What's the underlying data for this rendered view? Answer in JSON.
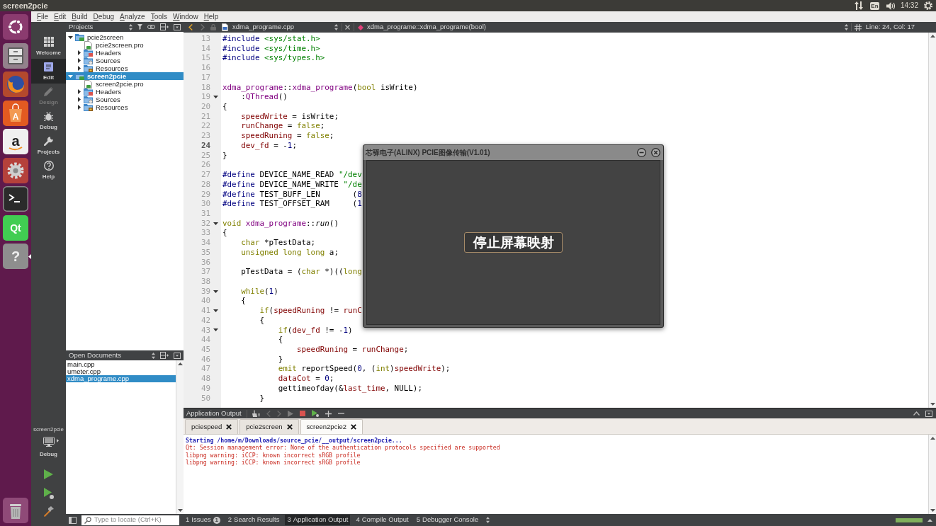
{
  "top_panel": {
    "title": "screen2pcie",
    "keyboard": "En",
    "time": "14:32"
  },
  "launcher": [
    {
      "kind": "dash",
      "focused": false
    },
    {
      "kind": "files",
      "focused": false
    },
    {
      "kind": "browser",
      "focused": false
    },
    {
      "kind": "software",
      "glyph": "A",
      "focused": false
    },
    {
      "kind": "store",
      "glyph": "a",
      "focused": false
    },
    {
      "kind": "settings",
      "focused": false
    },
    {
      "kind": "terminal",
      "focused": false
    },
    {
      "kind": "qt",
      "glyph": "Qt",
      "focused": false
    },
    {
      "kind": "help",
      "glyph": "?",
      "focused": true
    },
    {
      "kind": "trash",
      "focused": false
    }
  ],
  "menu": [
    "File",
    "Edit",
    "Build",
    "Debug",
    "Analyze",
    "Tools",
    "Window",
    "Help"
  ],
  "modes": [
    {
      "label": "Welcome",
      "selected": false,
      "disabled": false
    },
    {
      "label": "Edit",
      "selected": true,
      "disabled": false
    },
    {
      "label": "Design",
      "selected": false,
      "disabled": true
    },
    {
      "label": "Debug",
      "selected": false,
      "disabled": false
    },
    {
      "label": "Projects",
      "selected": false,
      "disabled": false
    },
    {
      "label": "Help",
      "selected": false,
      "disabled": false
    }
  ],
  "kit": {
    "project": "screen2pcie",
    "config": "Debug"
  },
  "projects": {
    "title": "Projects",
    "tree": [
      {
        "name": "pcie2screen",
        "kind": "project",
        "expanded": true,
        "selected": false,
        "children": [
          {
            "name": "pcie2screen.pro",
            "kind": "profile",
            "selected": false
          },
          {
            "name": "Headers",
            "kind": "headers",
            "expanded": false,
            "selected": false
          },
          {
            "name": "Sources",
            "kind": "sources",
            "expanded": false,
            "selected": false
          },
          {
            "name": "Resources",
            "kind": "resources",
            "expanded": false,
            "selected": false
          }
        ]
      },
      {
        "name": "screen2pcie",
        "kind": "project",
        "expanded": true,
        "selected": true,
        "children": [
          {
            "name": "screen2pcie.pro",
            "kind": "profile",
            "selected": false
          },
          {
            "name": "Headers",
            "kind": "headers",
            "expanded": false,
            "selected": false
          },
          {
            "name": "Sources",
            "kind": "sources",
            "expanded": false,
            "selected": false
          },
          {
            "name": "Resources",
            "kind": "resources",
            "expanded": false,
            "selected": false
          }
        ]
      }
    ]
  },
  "open_documents": {
    "title": "Open Documents",
    "items": [
      {
        "name": "main.cpp",
        "selected": false
      },
      {
        "name": "umeter.cpp",
        "selected": false
      },
      {
        "name": "xdma_programe.cpp",
        "selected": true
      }
    ]
  },
  "editor": {
    "file": "xdma_programe.cpp",
    "symbol": "xdma_programe::xdma_programe(bool)",
    "position": "Line: 24, Col: 17",
    "lines": [
      {
        "number": "13",
        "foldable": false,
        "current": false,
        "tokens": [
          {
            "text": "#include",
            "kind": "preprocessor"
          },
          {
            "text": " <sys/stat.h>",
            "kind": "string"
          }
        ]
      },
      {
        "number": "14",
        "foldable": false,
        "current": false,
        "tokens": [
          {
            "text": "#include",
            "kind": "preprocessor"
          },
          {
            "text": " <sys/time.h>",
            "kind": "string"
          }
        ]
      },
      {
        "number": "15",
        "foldable": false,
        "current": false,
        "tokens": [
          {
            "text": "#include",
            "kind": "preprocessor"
          },
          {
            "text": " <sys/types.h>",
            "kind": "string"
          }
        ]
      },
      {
        "number": "16",
        "foldable": false,
        "current": false
      },
      {
        "number": "17",
        "foldable": false,
        "current": false
      },
      {
        "number": "18",
        "foldable": false,
        "current": false,
        "tokens": [
          {
            "text": "xdma_programe",
            "kind": "type"
          },
          {
            "text": "::",
            "kind": "plain"
          },
          {
            "text": "xdma_programe",
            "kind": "type"
          },
          {
            "text": "(",
            "kind": "plain"
          },
          {
            "text": "bool",
            "kind": "keyword"
          },
          {
            "text": " isWrite)",
            "kind": "plain"
          }
        ]
      },
      {
        "number": "19",
        "foldable": true,
        "current": false,
        "tokens": [
          {
            "text": "    :",
            "kind": "plain"
          },
          {
            "text": "QThread",
            "kind": "type"
          },
          {
            "text": "()",
            "kind": "plain"
          }
        ]
      },
      {
        "number": "20",
        "foldable": false,
        "current": false,
        "tokens": [
          {
            "text": "{",
            "kind": "plain"
          }
        ]
      },
      {
        "number": "21",
        "foldable": false,
        "current": false,
        "tokens": [
          {
            "text": "    speedWrite",
            "kind": "field"
          },
          {
            "text": " = isWrite;",
            "kind": "plain"
          }
        ]
      },
      {
        "number": "22",
        "foldable": false,
        "current": false,
        "tokens": [
          {
            "text": "    runChange",
            "kind": "field"
          },
          {
            "text": " = ",
            "kind": "plain"
          },
          {
            "text": "false",
            "kind": "keyword"
          },
          {
            "text": ";",
            "kind": "plain"
          }
        ]
      },
      {
        "number": "23",
        "foldable": false,
        "current": false,
        "tokens": [
          {
            "text": "    speedRuning",
            "kind": "field"
          },
          {
            "text": " = ",
            "kind": "plain"
          },
          {
            "text": "false",
            "kind": "keyword"
          },
          {
            "text": ";",
            "kind": "plain"
          }
        ]
      },
      {
        "number": "24",
        "foldable": false,
        "current": true,
        "tokens": [
          {
            "text": "    dev_fd",
            "kind": "field"
          },
          {
            "text": " = -",
            "kind": "plain"
          },
          {
            "text": "1",
            "kind": "number"
          },
          {
            "text": ";",
            "kind": "plain"
          }
        ]
      },
      {
        "number": "25",
        "foldable": false,
        "current": false,
        "tokens": [
          {
            "text": "}",
            "kind": "plain"
          }
        ]
      },
      {
        "number": "26",
        "foldable": false,
        "current": false
      },
      {
        "number": "27",
        "foldable": false,
        "current": false,
        "tokens": [
          {
            "text": "#define",
            "kind": "preprocessor"
          },
          {
            "text": " DEVICE_NAME_READ ",
            "kind": "plain"
          },
          {
            "text": "\"/dev",
            "kind": "string"
          }
        ]
      },
      {
        "number": "28",
        "foldable": false,
        "current": false,
        "tokens": [
          {
            "text": "#define",
            "kind": "preprocessor"
          },
          {
            "text": " DEVICE_NAME_WRITE ",
            "kind": "plain"
          },
          {
            "text": "\"/de",
            "kind": "string"
          }
        ]
      },
      {
        "number": "29",
        "foldable": false,
        "current": false,
        "tokens": [
          {
            "text": "#define",
            "kind": "preprocessor"
          },
          {
            "text": " TEST_BUFF_LEN       (",
            "kind": "plain"
          },
          {
            "text": "8",
            "kind": "number"
          }
        ]
      },
      {
        "number": "30",
        "foldable": false,
        "current": false,
        "tokens": [
          {
            "text": "#define",
            "kind": "preprocessor"
          },
          {
            "text": " TEST_OFFSET_RAM     (",
            "kind": "plain"
          },
          {
            "text": "1",
            "kind": "number"
          }
        ]
      },
      {
        "number": "31",
        "foldable": false,
        "current": false
      },
      {
        "number": "32",
        "foldable": true,
        "current": false,
        "tokens": [
          {
            "text": "void",
            "kind": "keyword"
          },
          {
            "text": " xdma_programe",
            "kind": "type"
          },
          {
            "text": "::",
            "kind": "plain"
          },
          {
            "text": "run",
            "kind": "virtual"
          },
          {
            "text": "()",
            "kind": "plain"
          }
        ]
      },
      {
        "number": "33",
        "foldable": false,
        "current": false,
        "tokens": [
          {
            "text": "{",
            "kind": "plain"
          }
        ]
      },
      {
        "number": "34",
        "foldable": false,
        "current": false,
        "tokens": [
          {
            "text": "    char",
            "kind": "keyword"
          },
          {
            "text": " *pTestData;",
            "kind": "plain"
          }
        ]
      },
      {
        "number": "35",
        "foldable": false,
        "current": false,
        "tokens": [
          {
            "text": "    unsigned long long",
            "kind": "keyword"
          },
          {
            "text": " a;",
            "kind": "plain"
          }
        ]
      },
      {
        "number": "36",
        "foldable": false,
        "current": false
      },
      {
        "number": "37",
        "foldable": false,
        "current": false,
        "tokens": [
          {
            "text": "    pTestData = (",
            "kind": "plain"
          },
          {
            "text": "char",
            "kind": "keyword"
          },
          {
            "text": " *)((",
            "kind": "plain"
          },
          {
            "text": "long",
            "kind": "keyword"
          }
        ]
      },
      {
        "number": "38",
        "foldable": false,
        "current": false
      },
      {
        "number": "39",
        "foldable": true,
        "current": false,
        "tokens": [
          {
            "text": "    while",
            "kind": "keyword"
          },
          {
            "text": "(",
            "kind": "plain"
          },
          {
            "text": "1",
            "kind": "number"
          },
          {
            "text": ")",
            "kind": "plain"
          }
        ]
      },
      {
        "number": "40",
        "foldable": false,
        "current": false,
        "tokens": [
          {
            "text": "    {",
            "kind": "plain"
          }
        ]
      },
      {
        "number": "41",
        "foldable": true,
        "current": false,
        "tokens": [
          {
            "text": "        if",
            "kind": "keyword"
          },
          {
            "text": "(",
            "kind": "plain"
          },
          {
            "text": "speedRuning",
            "kind": "field"
          },
          {
            "text": " != ",
            "kind": "plain"
          },
          {
            "text": "runC",
            "kind": "field"
          }
        ]
      },
      {
        "number": "42",
        "foldable": false,
        "current": false,
        "tokens": [
          {
            "text": "        {",
            "kind": "plain"
          }
        ]
      },
      {
        "number": "43",
        "foldable": true,
        "current": false,
        "tokens": [
          {
            "text": "            if",
            "kind": "keyword"
          },
          {
            "text": "(",
            "kind": "plain"
          },
          {
            "text": "dev_fd",
            "kind": "field"
          },
          {
            "text": " != -",
            "kind": "plain"
          },
          {
            "text": "1",
            "kind": "number"
          },
          {
            "text": ")",
            "kind": "plain"
          }
        ]
      },
      {
        "number": "44",
        "foldable": false,
        "current": false,
        "tokens": [
          {
            "text": "            {",
            "kind": "plain"
          }
        ]
      },
      {
        "number": "45",
        "foldable": false,
        "current": false,
        "tokens": [
          {
            "text": "                speedRuning",
            "kind": "field"
          },
          {
            "text": " = ",
            "kind": "plain"
          },
          {
            "text": "runChange",
            "kind": "field"
          },
          {
            "text": ";",
            "kind": "plain"
          }
        ]
      },
      {
        "number": "46",
        "foldable": false,
        "current": false,
        "tokens": [
          {
            "text": "            }",
            "kind": "plain"
          }
        ]
      },
      {
        "number": "47",
        "foldable": false,
        "current": false,
        "tokens": [
          {
            "text": "            emit",
            "kind": "keyword"
          },
          {
            "text": " reportSpeed(",
            "kind": "plain"
          },
          {
            "text": "0",
            "kind": "number"
          },
          {
            "text": ", (",
            "kind": "plain"
          },
          {
            "text": "int",
            "kind": "keyword"
          },
          {
            "text": ")",
            "kind": "plain"
          },
          {
            "text": "speedWrite",
            "kind": "field"
          },
          {
            "text": ");",
            "kind": "plain"
          }
        ]
      },
      {
        "number": "48",
        "foldable": false,
        "current": false,
        "tokens": [
          {
            "text": "            dataCot",
            "kind": "field"
          },
          {
            "text": " = ",
            "kind": "plain"
          },
          {
            "text": "0",
            "kind": "number"
          },
          {
            "text": ";",
            "kind": "plain"
          }
        ]
      },
      {
        "number": "49",
        "foldable": false,
        "current": false,
        "tokens": [
          {
            "text": "            gettimeofday(&",
            "kind": "plain"
          },
          {
            "text": "last_time",
            "kind": "field"
          },
          {
            "text": ", NULL);",
            "kind": "plain"
          }
        ]
      },
      {
        "number": "50",
        "foldable": false,
        "current": false,
        "tokens": [
          {
            "text": "        }",
            "kind": "plain"
          }
        ]
      }
    ]
  },
  "output": {
    "title": "Application Output",
    "tabs": [
      {
        "label": "pciespeed",
        "selected": false
      },
      {
        "label": "pcie2screen",
        "selected": false
      },
      {
        "label": "screen2pcie2",
        "selected": true
      }
    ],
    "lines": [
      {
        "text": "Starting /home/m/Downloads/source_pcie/__output/screen2pcie...",
        "kind": "info"
      },
      {
        "text": "Qt: Session management error: None of the authentication protocols specified are supported",
        "kind": "error"
      },
      {
        "text": "libpng warning: iCCP: known incorrect sRGB profile",
        "kind": "error"
      },
      {
        "text": "libpng warning: iCCP: known incorrect sRGB profile",
        "kind": "error"
      }
    ]
  },
  "statusbar": {
    "locate_placeholder": "Type to locate (Ctrl+K)",
    "panes": [
      {
        "number": "1",
        "label": "Issues",
        "badge": "1",
        "selected": false
      },
      {
        "number": "2",
        "label": "Search Results",
        "selected": false
      },
      {
        "number": "3",
        "label": "Application Output",
        "selected": true
      },
      {
        "number": "4",
        "label": "Compile Output",
        "selected": false
      },
      {
        "number": "5",
        "label": "Debugger Console",
        "selected": false
      }
    ],
    "progress": {
      "level": 1
    }
  },
  "dialog": {
    "title": "芯驿电子(ALINX) PCIE图像传输(V1.01)",
    "button": "停止屏幕映射"
  }
}
